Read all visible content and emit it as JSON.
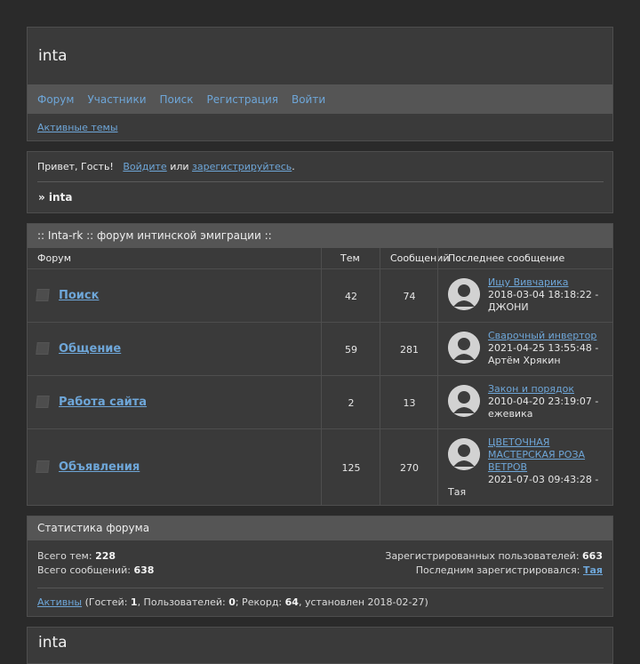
{
  "header": {
    "title": "inta",
    "nav": [
      "Форум",
      "Участники",
      "Поиск",
      "Регистрация",
      "Войти"
    ],
    "active_topics": "Активные темы"
  },
  "welcome": {
    "greeting": "Привет, Гость!",
    "login_link": "Войдите",
    "or": "или",
    "register_link": "зарегистрируйтесь",
    "period": ".",
    "breadcrumb": "» inta"
  },
  "forum": {
    "category": ":: Inta-rk :: форум интинской эмиграции ::",
    "columns": {
      "forum": "Форум",
      "topics": "Тем",
      "posts": "Сообщений",
      "last": "Последнее сообщение"
    },
    "rows": [
      {
        "name": "Поиск",
        "topics": "42",
        "posts": "74",
        "last_title": "Ищу Вивчарика",
        "last_date": "2018-03-04 18:18:22 -",
        "last_author": "ДЖОНИ"
      },
      {
        "name": "Общение",
        "topics": "59",
        "posts": "281",
        "last_title": "Сварочный инвертор",
        "last_date": "2021-04-25 13:55:48 -",
        "last_author": "Артём Хрякин"
      },
      {
        "name": "Работа сайта",
        "topics": "2",
        "posts": "13",
        "last_title": "Закон и порядок",
        "last_date": "2010-04-20 23:19:07 -",
        "last_author": "ежевика"
      },
      {
        "name": "Объявления",
        "topics": "125",
        "posts": "270",
        "last_title": "ЦВЕТОЧНАЯ МАСТЕРСКАЯ РОЗА ВЕТРОВ",
        "last_date": "2021-07-03 09:43:28 -",
        "last_author": "Тая"
      }
    ]
  },
  "stats": {
    "title": "Статистика форума",
    "topics_label": "Всего тем:",
    "topics_value": "228",
    "posts_label": "Всего сообщений:",
    "posts_value": "638",
    "users_label": "Зарегистрированных пользователей:",
    "users_value": "663",
    "last_reg_label": "Последним зарегистрировался:",
    "last_reg_value": "Тая",
    "online_link": "Активны",
    "guests_label": " (Гостей: ",
    "guests_value": "1",
    "users_online_label": ", Пользователей: ",
    "users_online_value": "0",
    "record_label": "; Рекорд: ",
    "record_value": "64",
    "record_date": ", установлен 2018-02-27)"
  },
  "footer": {
    "title": "inta"
  },
  "colors": {
    "background": "#2a2a2a",
    "panel": "#3a3a3a",
    "header_bar": "#555555",
    "link": "#6ea6d8"
  }
}
